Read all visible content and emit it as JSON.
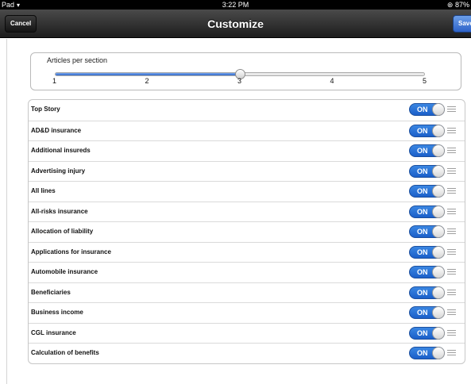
{
  "status_bar": {
    "device": "Pad",
    "time": "3:22 PM",
    "battery": "87%"
  },
  "nav": {
    "title": "Customize",
    "cancel_label": "Cancel",
    "save_label": "Save"
  },
  "slider": {
    "label": "Articles per section",
    "ticks": [
      "1",
      "2",
      "3",
      "4",
      "5"
    ],
    "value": 3,
    "min": 1,
    "max": 5
  },
  "toggle_label": "ON",
  "rows": [
    {
      "label": "Top Story",
      "state": "ON"
    },
    {
      "label": "AD&D insurance",
      "state": "ON"
    },
    {
      "label": "Additional insureds",
      "state": "ON"
    },
    {
      "label": "Advertising injury",
      "state": "ON"
    },
    {
      "label": "All lines",
      "state": "ON"
    },
    {
      "label": "All-risks insurance",
      "state": "ON"
    },
    {
      "label": "Allocation of liability",
      "state": "ON"
    },
    {
      "label": "Applications for insurance",
      "state": "ON"
    },
    {
      "label": "Automobile insurance",
      "state": "ON"
    },
    {
      "label": "Beneficiaries",
      "state": "ON"
    },
    {
      "label": "Business income",
      "state": "ON"
    },
    {
      "label": "CGL insurance",
      "state": "ON"
    },
    {
      "label": "Calculation of benefits",
      "state": "ON"
    }
  ]
}
